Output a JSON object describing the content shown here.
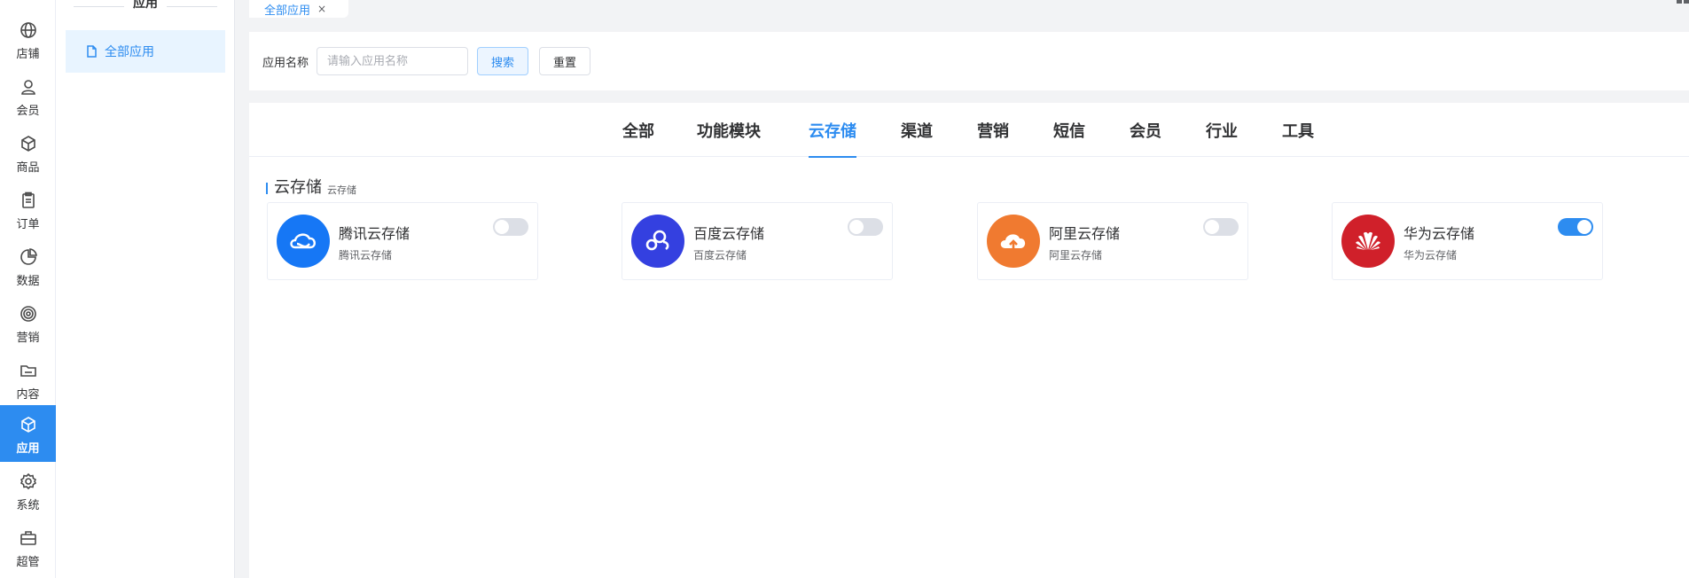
{
  "rail": {
    "items": [
      {
        "label": "店铺",
        "icon": "globe-icon"
      },
      {
        "label": "会员",
        "icon": "user-icon"
      },
      {
        "label": "商品",
        "icon": "box-icon"
      },
      {
        "label": "订单",
        "icon": "clipboard-icon"
      },
      {
        "label": "数据",
        "icon": "pie-chart-icon"
      },
      {
        "label": "营销",
        "icon": "target-icon"
      },
      {
        "label": "内容",
        "icon": "folder-icon"
      },
      {
        "label": "应用",
        "icon": "cube-icon",
        "active": true
      },
      {
        "label": "系统",
        "icon": "gear-icon"
      },
      {
        "label": "超管",
        "icon": "briefcase-icon"
      }
    ]
  },
  "submenu": {
    "title": "应用",
    "item": "全部应用"
  },
  "tabs": {
    "active_label": "全部应用",
    "close": "×"
  },
  "search": {
    "label": "应用名称",
    "placeholder": "请输入应用名称",
    "value": "",
    "search_button": "搜索",
    "reset_button": "重置"
  },
  "categories": [
    "全部",
    "功能模块",
    "云存储",
    "渠道",
    "营销",
    "短信",
    "会员",
    "行业",
    "工具"
  ],
  "active_category": "云存储",
  "section": {
    "title": "云存储",
    "subtitle": "云存储"
  },
  "apps": [
    {
      "name": "腾讯云存储",
      "desc": "腾讯云存储",
      "enabled": false,
      "color": "#1677f5",
      "icon": "tencent-cloud-icon"
    },
    {
      "name": "百度云存储",
      "desc": "百度云存储",
      "enabled": false,
      "color": "#3440e0",
      "icon": "baidu-cloud-icon"
    },
    {
      "name": "阿里云存储",
      "desc": "阿里云存储",
      "enabled": false,
      "color": "#f07a30",
      "icon": "aliyun-icon"
    },
    {
      "name": "华为云存储",
      "desc": "华为云存储",
      "enabled": true,
      "color": "#d0202a",
      "icon": "huawei-icon"
    }
  ],
  "colors": {
    "accent": "#2d8cf0",
    "toggle_off": "#dcdfe6"
  }
}
